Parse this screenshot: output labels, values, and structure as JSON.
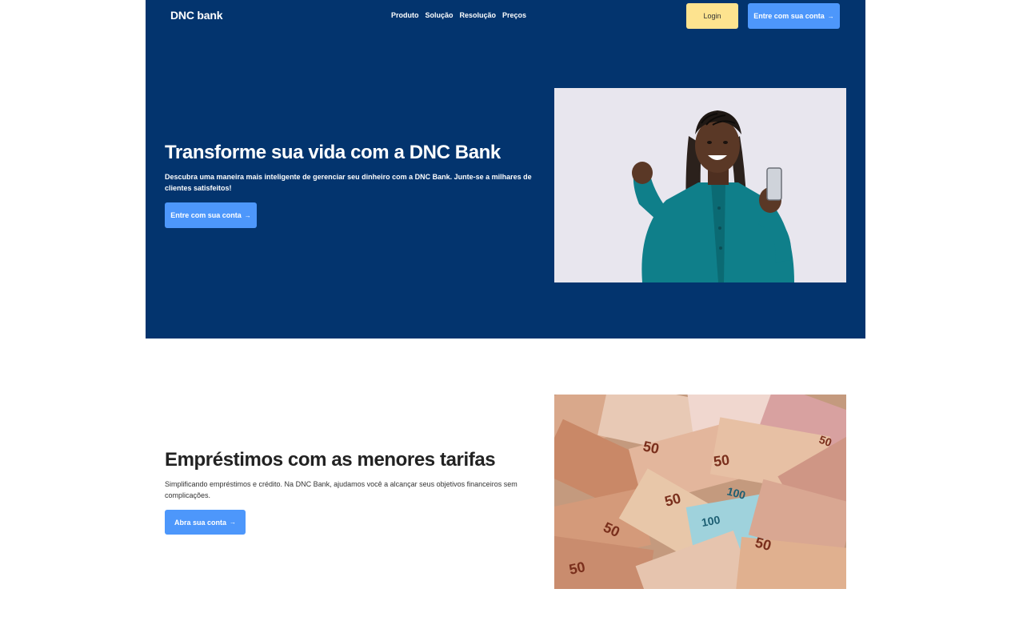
{
  "nav": {
    "logo": "DNC bank",
    "links": [
      "Produto",
      "Solução",
      "Resolução",
      "Preços"
    ],
    "login_label": "Login",
    "cta_label": "Entre com sua conta"
  },
  "hero": {
    "title": "Transforme sua vida com a DNC Bank",
    "text": "Descubra uma maneira mais inteligente de gerenciar seu dinheiro com a DNC Bank. Junte-se a milhares de clientes satisfeitos!",
    "cta_label": "Entre com sua conta"
  },
  "loans": {
    "title": "Empréstimos com as menores tarifas",
    "text": "Simplificando empréstimos e crédito. Na DNC Bank, ajudamos você a alcançar seus objetivos financeiros sem complicações.",
    "cta_label": "Abra sua conta"
  },
  "icons": {
    "arrow": "arrow-right-icon"
  },
  "colors": {
    "hero_bg": "#03346e",
    "accent_blue": "#4d97fb",
    "login_yellow": "#fde38f"
  }
}
